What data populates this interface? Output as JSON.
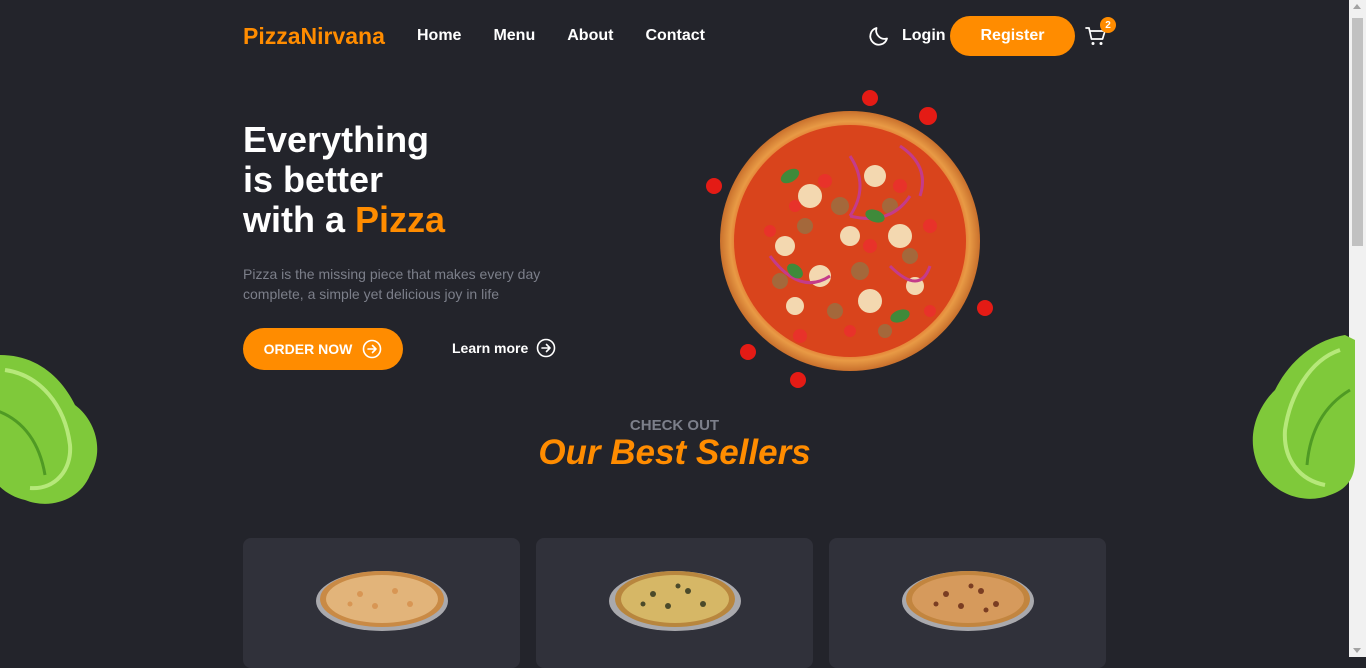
{
  "header": {
    "brand": "PizzaNirvana",
    "nav": [
      "Home",
      "Menu",
      "About",
      "Contact"
    ],
    "login_label": "Login",
    "register_label": "Register",
    "cart_count": "2",
    "theme_icon": "moon-icon",
    "cart_icon": "cart-icon"
  },
  "hero": {
    "title_line1": "Everything",
    "title_line2": "is better",
    "title_line3_prefix": "with a ",
    "title_line3_accent": "Pizza",
    "subtitle": "Pizza is the missing piece that makes every day complete, a simple yet delicious joy in life",
    "order_label": "ORDER NOW",
    "learn_label": "Learn more"
  },
  "best_sellers": {
    "kicker": "CHECK OUT",
    "title": "Our Best Sellers"
  },
  "colors": {
    "background": "#23242b",
    "accent": "#ff8c00",
    "card": "#30313a",
    "muted": "#7c7f8a"
  }
}
